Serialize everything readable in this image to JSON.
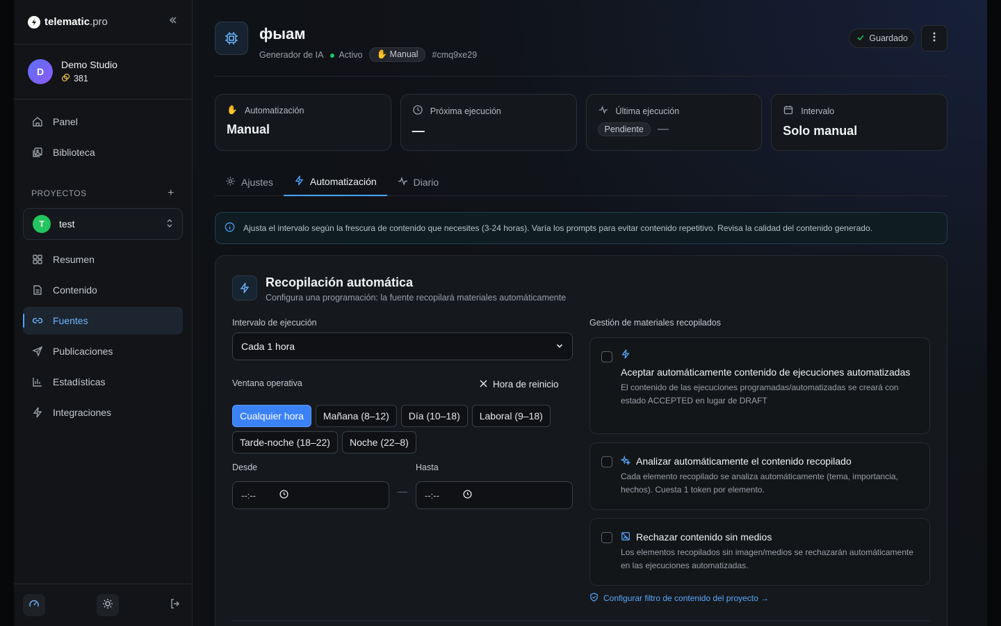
{
  "app": {
    "logo_text": "telematic",
    "logo_suffix": ".pro"
  },
  "studio": {
    "initial": "D",
    "name": "Demo Studio",
    "tokens": "381"
  },
  "nav": {
    "panel": "Panel",
    "library": "Biblioteca",
    "projects_heading": "PROYECTOS",
    "project_initial": "T",
    "project_name": "test",
    "items": [
      "Resumen",
      "Contenido",
      "Fuentes",
      "Publicaciones",
      "Estadísticas",
      "Integraciones"
    ]
  },
  "header": {
    "title": "фыам",
    "type": "Generador de IA",
    "status": "Activo",
    "mode": "Manual",
    "id": "#cmq9xe29",
    "saved": "Guardado"
  },
  "stats": [
    {
      "label": "Automatización",
      "value": "Manual"
    },
    {
      "label": "Próxima ejecución",
      "value": "—"
    },
    {
      "label": "Última ejecución",
      "value": "Pendiente",
      "extra": "—"
    },
    {
      "label": "Intervalo",
      "value": "Solo manual"
    }
  ],
  "tabs": [
    "Ajustes",
    "Automatización",
    "Diario"
  ],
  "active_tab": "Automatización",
  "info_text": "Ajusta el intervalo según la frescura de contenido que necesites (3-24 horas). Varía los prompts para evitar contenido repetitivo. Revisa la calidad del contenido generado.",
  "panel": {
    "title": "Recopilación automática",
    "subtitle": "Configura una programación: la fuente recopilará materiales automáticamente",
    "interval_label": "Intervalo de ejecución",
    "interval_value": "Cada 1 hora",
    "window_label": "Ventana operativa",
    "reset_label": "Hora de reinicio",
    "chips": [
      "Cualquier hora",
      "Mañana (8–12)",
      "Día (10–18)",
      "Laboral (9–18)",
      "Tarde-noche (18–22)",
      "Noche (22–8)"
    ],
    "active_chip": "Cualquier hora",
    "from_label": "Desde",
    "to_label": "Hasta",
    "time_placeholder": "--:--",
    "range_separator": "—",
    "materials_label": "Gestión de materiales recopilados",
    "options": [
      {
        "title": "Aceptar automáticamente contenido de ejecuciones automatizadas",
        "desc": "El contenido de las ejecuciones programadas/automatizadas se creará con estado ACCEPTED en lugar de DRAFT",
        "icon": "bolt-icon",
        "checked": false
      },
      {
        "title": "Analizar automáticamente el contenido recopilado",
        "desc": "Cada elemento recopilado se analiza automáticamente (tema, importancia, hechos). Cuesta 1 token por elemento.",
        "icon": "sparkles-icon",
        "checked": false
      },
      {
        "title": "Rechazar contenido sin medios",
        "desc": "Los elementos recopilados sin imagen/medios se rechazarán automáticamente en las ejecuciones automatizadas.",
        "icon": "image-off-icon",
        "checked": false
      }
    ],
    "filter_link": "Configurar filtro de contenido del proyecto →"
  },
  "colors": {
    "accent": "#4aa3ff",
    "active_chip": "#3b82f6",
    "success": "#22c55e"
  }
}
